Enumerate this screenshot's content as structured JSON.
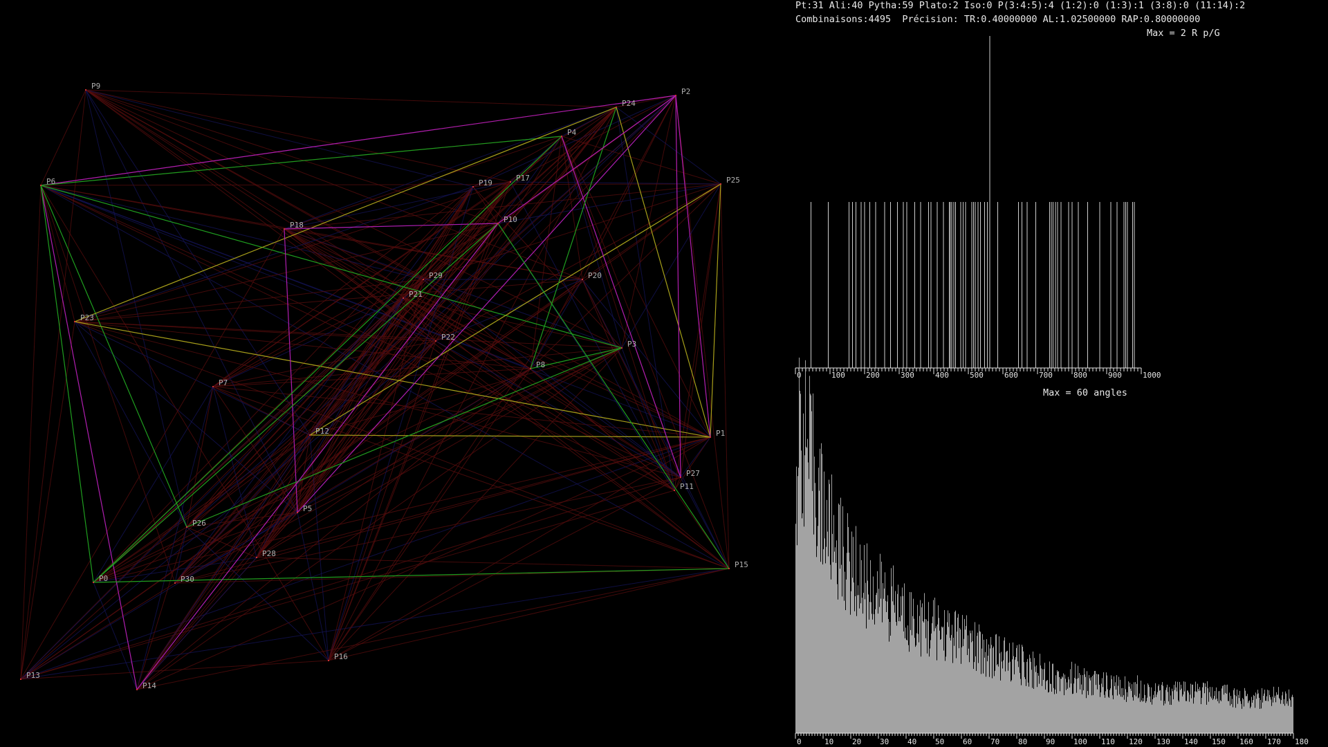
{
  "header": {
    "line1": "Pt:31 Ali:40 Pytha:59 Plato:2 Iso:0 P(3:4:5):4 (1:2):0 (1:3):1 (3:8):0 (11:14):2",
    "line2": "Combinaisons:4495  Précision: TR:0.40000000 AL:1.02500000 RAP:0.80000000"
  },
  "colors": {
    "background": "#000000",
    "point": "#cc3333",
    "label": "#b0b0b0",
    "green": "#1f9e1f",
    "magenta": "#b01eb0",
    "yellow": "#a6a01a",
    "darkred": "#5a0d0d",
    "darkblue": "#14145a",
    "bar": "#a3a3a3",
    "axis": "#e6e6e6"
  },
  "points": [
    {
      "label": "P0",
      "x": 135,
      "y": 842
    },
    {
      "label": "P1",
      "x": 1027,
      "y": 632
    },
    {
      "label": "P2",
      "x": 977,
      "y": 138
    },
    {
      "label": "P3",
      "x": 899,
      "y": 503
    },
    {
      "label": "P4",
      "x": 812,
      "y": 197
    },
    {
      "label": "P5",
      "x": 430,
      "y": 741
    },
    {
      "label": "P6",
      "x": 59,
      "y": 268
    },
    {
      "label": "P7",
      "x": 308,
      "y": 559
    },
    {
      "label": "P8",
      "x": 767,
      "y": 533
    },
    {
      "label": "P9",
      "x": 124,
      "y": 130
    },
    {
      "label": "P10",
      "x": 720,
      "y": 323
    },
    {
      "label": "P11",
      "x": 975,
      "y": 709
    },
    {
      "label": "P12",
      "x": 448,
      "y": 629
    },
    {
      "label": "P13",
      "x": 30,
      "y": 982
    },
    {
      "label": "P14",
      "x": 198,
      "y": 997
    },
    {
      "label": "P15",
      "x": 1054,
      "y": 822
    },
    {
      "label": "P16",
      "x": 475,
      "y": 955
    },
    {
      "label": "P17",
      "x": 738,
      "y": 263
    },
    {
      "label": "P18",
      "x": 411,
      "y": 331
    },
    {
      "label": "P19",
      "x": 684,
      "y": 270
    },
    {
      "label": "P20",
      "x": 842,
      "y": 404
    },
    {
      "label": "P21",
      "x": 583,
      "y": 431
    },
    {
      "label": "P22",
      "x": 630,
      "y": 493
    },
    {
      "label": "P23",
      "x": 108,
      "y": 465
    },
    {
      "label": "P24",
      "x": 891,
      "y": 155
    },
    {
      "label": "P25",
      "x": 1042,
      "y": 266
    },
    {
      "label": "P26",
      "x": 270,
      "y": 762
    },
    {
      "label": "P27",
      "x": 984,
      "y": 690
    },
    {
      "label": "P28",
      "x": 371,
      "y": 806
    },
    {
      "label": "P29",
      "x": 612,
      "y": 404
    },
    {
      "label": "P30",
      "x": 253,
      "y": 843
    }
  ],
  "highlight_lines": [
    {
      "from": "P6",
      "to": "P2",
      "color": "magenta"
    },
    {
      "from": "P6",
      "to": "P4",
      "color": "green"
    },
    {
      "from": "P6",
      "to": "P3",
      "color": "green"
    },
    {
      "from": "P6",
      "to": "P14",
      "color": "magenta"
    },
    {
      "from": "P6",
      "to": "P0",
      "color": "green"
    },
    {
      "from": "P6",
      "to": "P26",
      "color": "green"
    },
    {
      "from": "P23",
      "to": "P1",
      "color": "yellow"
    },
    {
      "from": "P23",
      "to": "P24",
      "color": "yellow"
    },
    {
      "from": "P24",
      "to": "P1",
      "color": "yellow"
    },
    {
      "from": "P12",
      "to": "P1",
      "color": "yellow"
    },
    {
      "from": "P12",
      "to": "P25",
      "color": "yellow"
    },
    {
      "from": "P25",
      "to": "P1",
      "color": "yellow"
    },
    {
      "from": "P2",
      "to": "P27",
      "color": "magenta"
    },
    {
      "from": "P2",
      "to": "P1",
      "color": "magenta"
    },
    {
      "from": "P4",
      "to": "P27",
      "color": "magenta"
    },
    {
      "from": "P2",
      "to": "P5",
      "color": "magenta"
    },
    {
      "from": "P18",
      "to": "P10",
      "color": "magenta"
    },
    {
      "from": "P18",
      "to": "P5",
      "color": "magenta"
    },
    {
      "from": "P10",
      "to": "P0",
      "color": "green"
    },
    {
      "from": "P10",
      "to": "P15",
      "color": "green"
    },
    {
      "from": "P0",
      "to": "P15",
      "color": "green"
    },
    {
      "from": "P24",
      "to": "P8",
      "color": "green"
    },
    {
      "from": "P8",
      "to": "P3",
      "color": "green"
    },
    {
      "from": "P26",
      "to": "P3",
      "color": "green"
    },
    {
      "from": "P4",
      "to": "P0",
      "color": "green"
    },
    {
      "from": "P10",
      "to": "P14",
      "color": "magenta"
    },
    {
      "from": "P2",
      "to": "P10",
      "color": "magenta"
    }
  ],
  "chart_data": [
    {
      "type": "bar",
      "title": "Max = 2 R p/G",
      "x_ticks": [
        "0",
        "100",
        "200",
        "300",
        "400",
        "500",
        "600",
        "700",
        "800",
        "900",
        "1000"
      ],
      "xlim": [
        0,
        1000
      ],
      "ylim": [
        0,
        2
      ],
      "x": [
        45,
        95,
        155,
        165,
        175,
        190,
        200,
        215,
        232,
        258,
        275,
        295,
        312,
        322,
        345,
        362,
        385,
        392,
        410,
        428,
        445,
        448,
        452,
        458,
        463,
        478,
        485,
        492,
        510,
        515,
        520,
        528,
        535,
        547,
        555,
        562,
        585,
        645,
        655,
        670,
        695,
        735,
        740,
        745,
        752,
        758,
        768,
        790,
        800,
        818,
        845,
        880,
        912,
        930,
        950,
        955,
        960,
        975,
        980
      ],
      "values": [
        1,
        1,
        1,
        1,
        1,
        1,
        1,
        1,
        1,
        1,
        1,
        1,
        1,
        1,
        1,
        1,
        1,
        1,
        1,
        1,
        1,
        1,
        1,
        1,
        1,
        1,
        1,
        1,
        1,
        1,
        1,
        1,
        1,
        1,
        1,
        2,
        1,
        1,
        1,
        1,
        1,
        1,
        1,
        1,
        1,
        1,
        1,
        1,
        1,
        1,
        1,
        1,
        1,
        1,
        1,
        1,
        1,
        1,
        1
      ]
    },
    {
      "type": "bar",
      "title": "Max = 60 angles",
      "x_ticks": [
        "0",
        "10",
        "20",
        "30",
        "40",
        "50",
        "60",
        "70",
        "80",
        "90",
        "100",
        "110",
        "120",
        "130",
        "140",
        "150",
        "160",
        "170",
        "180"
      ],
      "xlim": [
        0,
        180
      ],
      "ylim": [
        0,
        60
      ],
      "profile_x": [
        0,
        1,
        2,
        3,
        4,
        5,
        6,
        7,
        8,
        9,
        10,
        12,
        14,
        16,
        18,
        20,
        25,
        30,
        35,
        40,
        45,
        50,
        55,
        60,
        65,
        70,
        75,
        80,
        85,
        90,
        95,
        100,
        105,
        110,
        115,
        120,
        125,
        130,
        135,
        140,
        145,
        150,
        155,
        160,
        165,
        170,
        175,
        179
      ],
      "profile_values": [
        50,
        58,
        60,
        59,
        57,
        55,
        53,
        51,
        48,
        46,
        44,
        41,
        39,
        37,
        35,
        33,
        30,
        28,
        26,
        24,
        22,
        21,
        20,
        19,
        17,
        16,
        15,
        14,
        13,
        12,
        11,
        11,
        10,
        10,
        9,
        9,
        9,
        8,
        8,
        8,
        8,
        8,
        8,
        7,
        7,
        7,
        8,
        7
      ]
    }
  ]
}
